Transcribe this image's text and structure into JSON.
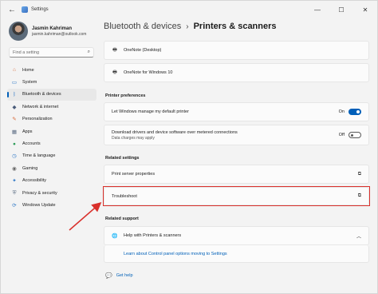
{
  "window": {
    "title": "Settings",
    "back_icon": "back-arrow-icon",
    "controls": [
      "minimize-icon",
      "maximize-icon",
      "close-icon"
    ]
  },
  "profile": {
    "name": "Jasmin Kahriman",
    "email": "jasmin.kahriman@outlook.com"
  },
  "search": {
    "placeholder": "Find a setting",
    "icon": "search-icon"
  },
  "sidebar": {
    "items": [
      {
        "label": "Home",
        "icon": "home-icon",
        "color": "#d86b3a",
        "active": false
      },
      {
        "label": "System",
        "icon": "system-icon",
        "color": "#2f78c6",
        "active": false
      },
      {
        "label": "Bluetooth & devices",
        "icon": "bluetooth-icon",
        "color": "#2f78c6",
        "active": true
      },
      {
        "label": "Network & internet",
        "icon": "network-icon",
        "color": "#4a5c7a",
        "active": false
      },
      {
        "label": "Personalization",
        "icon": "brush-icon",
        "color": "#d86b3a",
        "active": false
      },
      {
        "label": "Apps",
        "icon": "apps-icon",
        "color": "#5a6b82",
        "active": false
      },
      {
        "label": "Accounts",
        "icon": "accounts-icon",
        "color": "#2f9c5a",
        "active": false
      },
      {
        "label": "Time & language",
        "icon": "clock-icon",
        "color": "#2f78c6",
        "active": false
      },
      {
        "label": "Gaming",
        "icon": "gaming-icon",
        "color": "#6a6a6a",
        "active": false
      },
      {
        "label": "Accessibility",
        "icon": "accessibility-icon",
        "color": "#2f78c6",
        "active": false
      },
      {
        "label": "Privacy & security",
        "icon": "shield-icon",
        "color": "#5a6b82",
        "active": false
      },
      {
        "label": "Windows Update",
        "icon": "update-icon",
        "color": "#2f78c6",
        "active": false
      }
    ]
  },
  "breadcrumb": {
    "parent": "Bluetooth & devices",
    "separator": "›",
    "current": "Printers & scanners"
  },
  "printers": [
    {
      "label": "OneNote (Desktop)",
      "icon": "printer-icon"
    },
    {
      "label": "OneNote for Windows 10",
      "icon": "printer-icon"
    }
  ],
  "printer_preferences": {
    "title": "Printer preferences",
    "default_printer": {
      "label": "Let Windows manage my default printer",
      "state": "On"
    },
    "metered": {
      "line1": "Download drivers and device software over metered connections",
      "line2": "Data charges may apply",
      "state": "Off"
    }
  },
  "related_settings": {
    "title": "Related settings",
    "items": [
      {
        "label": "Print server properties",
        "icon": "external-link-icon"
      },
      {
        "label": "Troubleshoot",
        "icon": "external-link-icon"
      }
    ]
  },
  "related_support": {
    "title": "Related support",
    "header": "Help with Printers & scanners",
    "link": "Learn about Control panel options moving to Settings"
  },
  "get_help": {
    "label": "Get help",
    "icon": "help-icon"
  },
  "colors": {
    "accent": "#005fb8",
    "highlight": "#d9302b",
    "link": "#0060b8"
  }
}
